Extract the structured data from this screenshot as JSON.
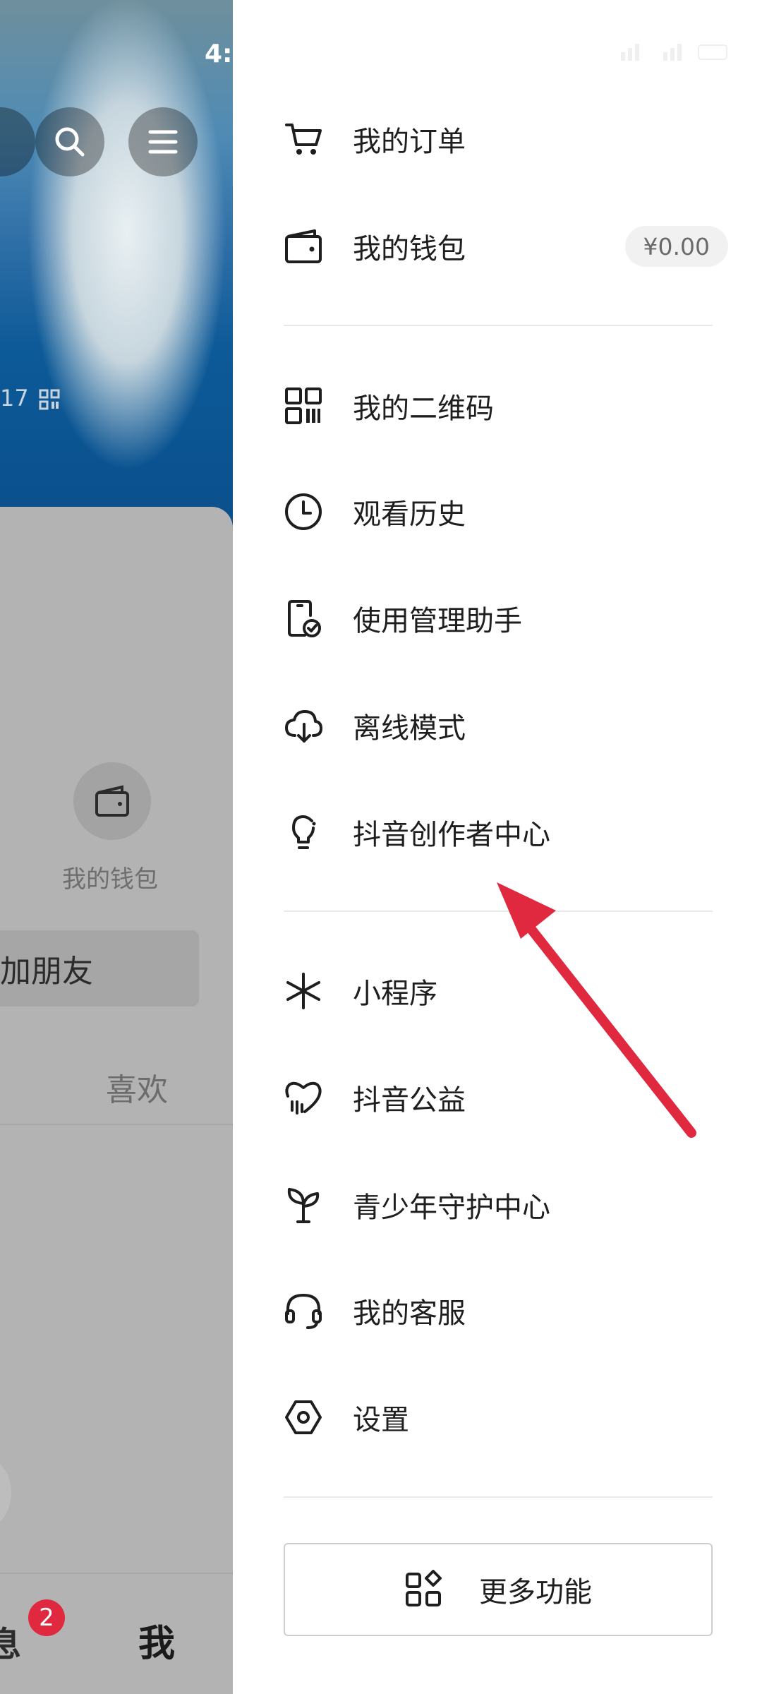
{
  "status_bar": {
    "time_partial": "4:5"
  },
  "left_profile": {
    "id_partial": "17",
    "wallet_label": "我的钱包",
    "add_friend_partial": "加朋友",
    "like_tab": "喜欢",
    "nav_message_partial": "息",
    "nav_message_badge": "2",
    "nav_me": "我"
  },
  "drawer": {
    "items": [
      {
        "label": "我的订单",
        "icon": "cart-icon"
      },
      {
        "label": "我的钱包",
        "icon": "wallet-icon",
        "badge": "¥0.00"
      },
      {
        "label": "我的二维码",
        "icon": "qr-code-icon"
      },
      {
        "label": "观看历史",
        "icon": "clock-icon"
      },
      {
        "label": "使用管理助手",
        "icon": "phone-check-icon"
      },
      {
        "label": "离线模式",
        "icon": "cloud-download-icon"
      },
      {
        "label": "抖音创作者中心",
        "icon": "lightbulb-icon"
      },
      {
        "label": "小程序",
        "icon": "mini-program-icon"
      },
      {
        "label": "抖音公益",
        "icon": "heart-hand-icon"
      },
      {
        "label": "青少年守护中心",
        "icon": "sprout-icon"
      },
      {
        "label": "我的客服",
        "icon": "headset-icon"
      },
      {
        "label": "设置",
        "icon": "settings-hexagon-icon"
      }
    ],
    "more_button": "更多功能"
  },
  "colors": {
    "annotation_arrow": "#e0283f",
    "badge_red": "#e0283f"
  }
}
